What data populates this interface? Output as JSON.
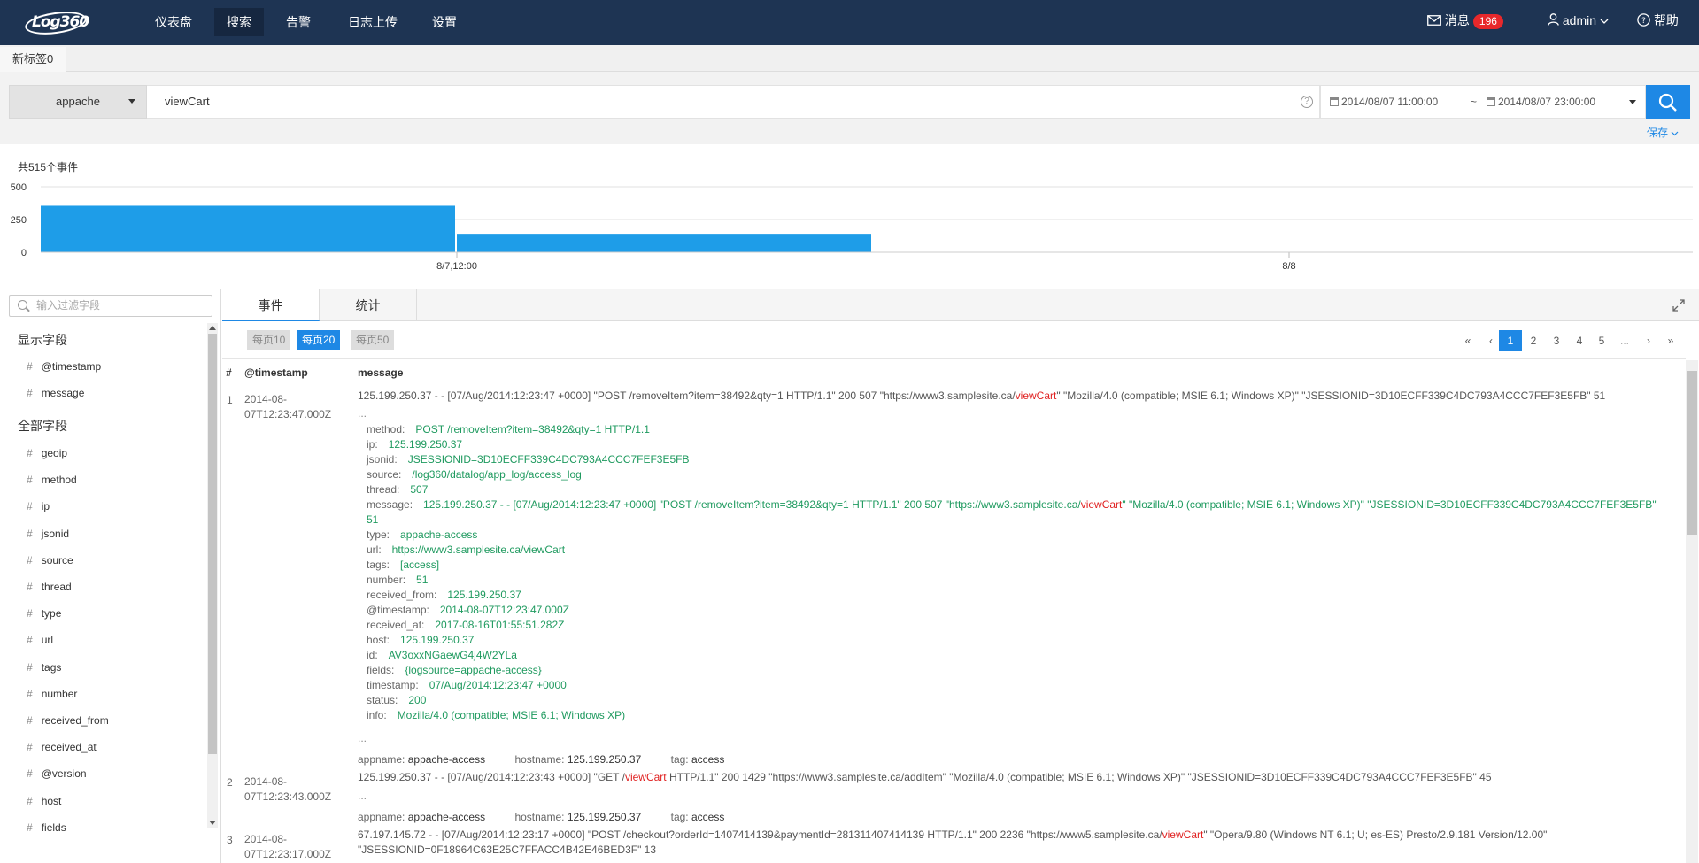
{
  "nav": {
    "logo": "Log360",
    "items": [
      "仪表盘",
      "搜索",
      "告警",
      "日志上传",
      "设置"
    ],
    "active_index": 1,
    "messages_label": "消息",
    "messages_count": "196",
    "user": "admin",
    "help": "帮助"
  },
  "tabs": {
    "new_tab": "新标签0"
  },
  "search": {
    "source": "appache",
    "query": "viewCart",
    "help_icon": "?",
    "time_from": "2014/08/07 11:00:00",
    "time_sep": "~",
    "time_to": "2014/08/07 23:00:00",
    "save_label": "保存"
  },
  "histogram": {
    "total_events": "共515个事件",
    "chart_data": {
      "type": "bar",
      "title": "",
      "yticks": [
        "500",
        "250",
        "0"
      ],
      "ylim": [
        0,
        500
      ],
      "xticks": [
        "8/7,12:00",
        "8/8"
      ],
      "bars": [
        {
          "from": "2014-08-07 06:00",
          "to": "2014-08-07 12:00",
          "value": 355
        },
        {
          "from": "2014-08-07 12:00",
          "to": "2014-08-07 18:00",
          "value": 141
        }
      ],
      "bar_color": "#1e9de8"
    }
  },
  "fields_panel": {
    "filter_placeholder": "输入过滤字段",
    "selected_title": "显示字段",
    "selected": [
      "@timestamp",
      "message"
    ],
    "all_title": "全部字段",
    "all": [
      "geoip",
      "method",
      "ip",
      "jsonid",
      "source",
      "thread",
      "type",
      "url",
      "tags",
      "number",
      "received_from",
      "received_at",
      "@version",
      "host",
      "fields"
    ]
  },
  "events": {
    "tabs": [
      "事件",
      "统计"
    ],
    "page_sizes": [
      "每页10",
      "每页20",
      "每页50"
    ],
    "active_page_size": 1,
    "pager": [
      "«",
      "‹",
      "1",
      "2",
      "3",
      "4",
      "5",
      "...",
      "›",
      "»"
    ],
    "active_page": "1",
    "columns": [
      "#",
      "@timestamp",
      "message"
    ],
    "rows": [
      {
        "no": "1",
        "ts": "2014-08-07T12:23:47.000Z",
        "raw_pre": "125.199.250.37 - - [07/Aug/2014:12:23:47 +0000] \"POST /removeItem?item=38492&qty=1 HTTP/1.1\" 200 507 \"https://www3.samplesite.ca/",
        "raw_hl": "viewCart",
        "raw_post": "\" \"Mozilla/4.0 (compatible; MSIE 6.1; Windows XP)\" \"JSESSIONID=3D10ECFF339C4DC793A4CCC7FEF3E5FB\" 51",
        "fields": [
          {
            "k": "method:",
            "v": "POST /removeItem?item=38492&qty=1 HTTP/1.1"
          },
          {
            "k": "ip:",
            "v": "125.199.250.37"
          },
          {
            "k": "jsonid:",
            "v": "JSESSIONID=3D10ECFF339C4DC793A4CCC7FEF3E5FB"
          },
          {
            "k": "source:",
            "v": "/log360/datalog/app_log/access_log"
          },
          {
            "k": "thread:",
            "v": "507"
          },
          {
            "k": "message:",
            "v": "125.199.250.37 - - [07/Aug/2014:12:23:47 +0000] \"POST /removeItem?item=38492&qty=1 HTTP/1.1\" 200 507 \"https://www3.samplesite.ca/",
            "hl": "viewCart",
            "v2": "\" \"Mozilla/4.0 (compatible; MSIE 6.1; Windows XP)\" \"JSESSIONID=3D10ECFF339C4DC793A4CCC7FEF3E5FB\"",
            "cont": "51"
          },
          {
            "k": "type:",
            "v": "appache-access"
          },
          {
            "k": "url:",
            "v": "https://www3.samplesite.ca/viewCart"
          },
          {
            "k": "tags:",
            "v": "[access]"
          },
          {
            "k": "number:",
            "v": "51"
          },
          {
            "k": "received_from:",
            "v": "125.199.250.37"
          },
          {
            "k": "@timestamp:",
            "v": "2014-08-07T12:23:47.000Z"
          },
          {
            "k": "received_at:",
            "v": "2017-08-16T01:55:51.282Z"
          },
          {
            "k": "host:",
            "v": "125.199.250.37"
          },
          {
            "k": "id:",
            "v": "AV3oxxNGaewG4j4W2YLa"
          },
          {
            "k": "fields:",
            "v": "{logsource=appache-access}"
          },
          {
            "k": "timestamp:",
            "v": "07/Aug/2014:12:23:47 +0000"
          },
          {
            "k": "status:",
            "v": "200"
          },
          {
            "k": "info:",
            "v": "Mozilla/4.0 (compatible; MSIE 6.1; Windows XP)"
          }
        ],
        "ellipsis": "...",
        "meta": {
          "appname_k": "appname:",
          "appname": "appache-access",
          "hostname_k": "hostname:",
          "hostname": "125.199.250.37",
          "tag_k": "tag:",
          "tag": "access"
        }
      },
      {
        "no": "2",
        "ts": "2014-08-07T12:23:43.000Z",
        "raw_pre": "125.199.250.37 - - [07/Aug/2014:12:23:43 +0000] \"GET /",
        "raw_hl": "viewCart",
        "raw_post": " HTTP/1.1\" 200 1429 \"https://www3.samplesite.ca/addItem\" \"Mozilla/4.0 (compatible; MSIE 6.1; Windows XP)\" \"JSESSIONID=3D10ECFF339C4DC793A4CCC7FEF3E5FB\" 45",
        "ellipsis": "...",
        "meta": {
          "appname_k": "appname:",
          "appname": "appache-access",
          "hostname_k": "hostname:",
          "hostname": "125.199.250.37",
          "tag_k": "tag:",
          "tag": "access"
        }
      },
      {
        "no": "3",
        "ts": "2014-08-07T12:23:17.000Z",
        "raw_pre": "67.197.145.72 - - [07/Aug/2014:12:23:17 +0000] \"POST /checkout?orderId=1407414139&paymentId=281311407414139 HTTP/1.1\" 200 2236 \"https://www5.samplesite.ca/",
        "raw_hl": "viewCart",
        "raw_post": "\" \"Opera/9.80 (Windows NT 6.1; U; es-ES) Presto/2.9.181 Version/12.00\"",
        "raw_line2": "\"JSESSIONID=0F18964C63E25C7FFACC4B42E46BED3F\" 13"
      }
    ]
  }
}
